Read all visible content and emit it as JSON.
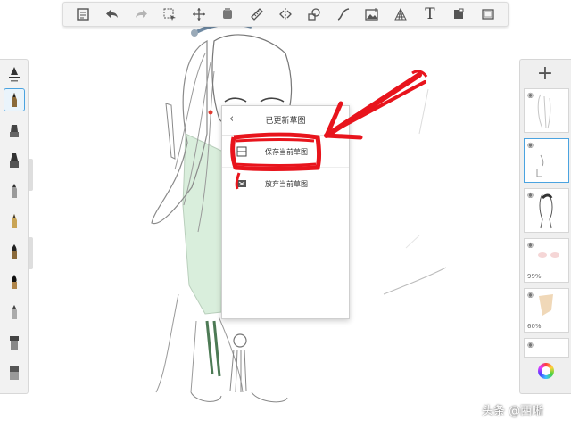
{
  "dialog": {
    "title": "已更新草图",
    "options": [
      {
        "label": "保存当前草图",
        "icon": "save-sketch-icon"
      },
      {
        "label": "放弃当前草图",
        "icon": "discard-sketch-icon"
      }
    ]
  },
  "toolbar": {
    "icons": [
      "gallery-icon",
      "undo-icon",
      "redo-icon",
      "selection-icon",
      "transform-icon",
      "layer-stack-icon",
      "ruler-icon",
      "symmetry-icon",
      "shapes-icon",
      "stroke-icon",
      "image-icon",
      "perspective-icon",
      "text-icon",
      "fill-icon",
      "fullscreen-icon"
    ],
    "text_tool": "T"
  },
  "brushes": [
    "pencil-brush",
    "ballpoint-brush",
    "marker-brush",
    "airbrush-brush",
    "chisel-brush",
    "fountain-pen-brush",
    "paint-brush",
    "ink-brush",
    "pencil-soft-brush",
    "flat-brush",
    "eraser-brush"
  ],
  "layers": {
    "add_label": "+",
    "items": [
      {
        "opacity": ""
      },
      {
        "opacity": ""
      },
      {
        "opacity": ""
      },
      {
        "opacity": "99%"
      },
      {
        "opacity": "60%"
      },
      {
        "opacity": ""
      }
    ]
  },
  "watermark": "头条 @西晰",
  "colors": {
    "accent": "#4aa3e0",
    "annotation": "#e8141c"
  }
}
